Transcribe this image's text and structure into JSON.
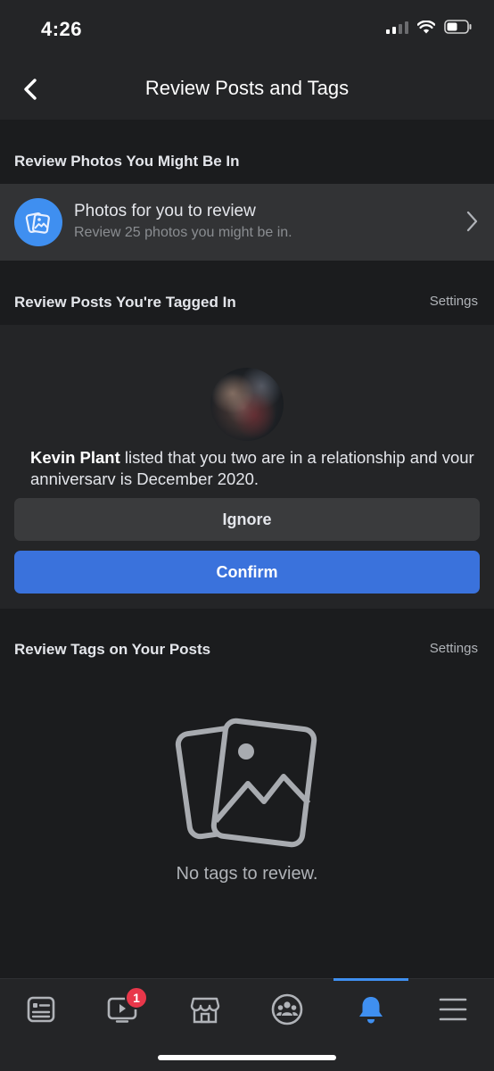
{
  "status_bar": {
    "time": "4:26"
  },
  "header": {
    "title": "Review Posts and Tags"
  },
  "sections": {
    "photos": {
      "title": "Review Photos You Might Be In"
    },
    "tagged": {
      "title": "Review Posts You're Tagged In",
      "settings_label": "Settings"
    },
    "tags_on_posts": {
      "title": "Review Tags on Your Posts",
      "settings_label": "Settings"
    }
  },
  "photos_row": {
    "title": "Photos for you to review",
    "subtitle": "Review 25 photos you might be in."
  },
  "tag_request": {
    "name": "Kevin Plant",
    "message": " listed that you two are in a relationship and vour anniversarv is December 2020.",
    "ignore_label": "Ignore",
    "confirm_label": "Confirm"
  },
  "empty_state": {
    "text": "No tags to review."
  },
  "tab_bar": {
    "watch_badge": "1",
    "active_tab": "notifications",
    "accent_color": "#3f8ff0"
  },
  "icons": {
    "back": "chevron-left-icon",
    "photos": "photos-icon",
    "row_chevron": "chevron-right-icon",
    "tabs": [
      "news-feed-icon",
      "watch-icon",
      "marketplace-icon",
      "groups-icon",
      "bell-icon",
      "menu-icon"
    ]
  }
}
